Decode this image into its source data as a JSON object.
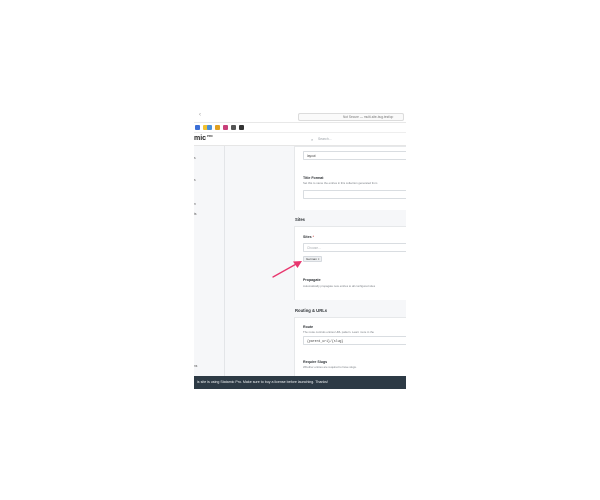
{
  "browser": {
    "back_glyph": "‹",
    "url": "Not Secure — multi-site-bug.test/cp"
  },
  "bookmarks": {
    "colors": [
      "#3b6fd6",
      "#f2c230",
      "#4a90d9",
      "#e0a020",
      "#c8407a",
      "#555555",
      "#333333"
    ]
  },
  "app": {
    "brand": "mic",
    "brand_badge": "PRO",
    "search_placeholder": "Search..."
  },
  "sidebar": {
    "items": [
      "s",
      "s",
      "n",
      "ts",
      "",
      "",
      "",
      "ns"
    ]
  },
  "main": {
    "layout_value": "layout",
    "title_format_label": "Title Format",
    "title_format_help": "Set this to name the entries in this collection generated from",
    "sites_section": "Sites",
    "sites_label": "Sites",
    "sites_required": "*",
    "sites_placeholder": "Choose...",
    "sites_tag": "German",
    "sites_tag_remove": "×",
    "propagate_label": "Propagate",
    "propagate_help": "Automatically propagate new entries to all configured sites",
    "routing_section": "Routing & URLs",
    "route_label": "Route",
    "route_help": "The route controls entries URL pattern. Learn more in the",
    "route_value": "{parent_uri}/{slug}",
    "require_slugs_label": "Require Slugs",
    "require_slugs_help": "Whether entries are required to have slugs."
  },
  "banner": {
    "text": "is site is using Statamic Pro. Make sure to buy a license before launching. Thanks!"
  },
  "colors": {
    "banner_bg": "#2d3a45",
    "arrow": "#e8366e",
    "page_bg": "#f6f7f9"
  }
}
